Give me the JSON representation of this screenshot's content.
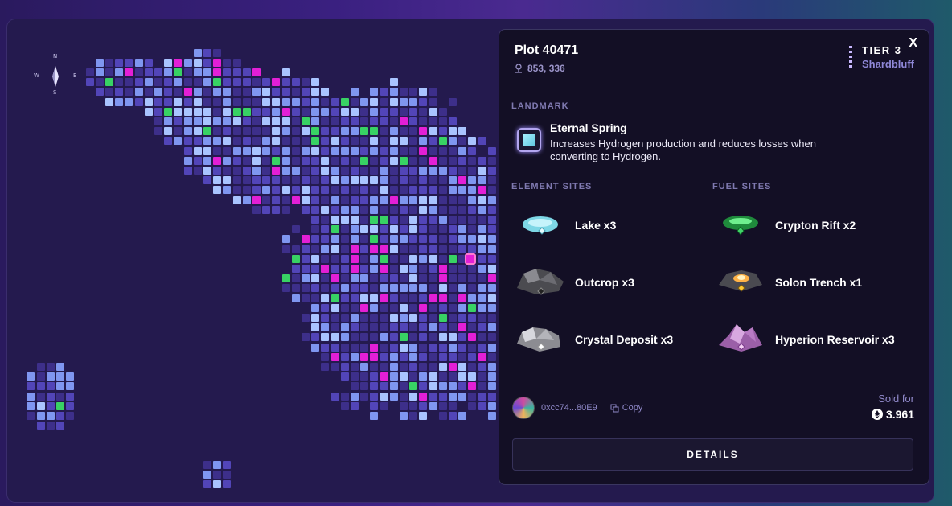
{
  "compass": {
    "n": "N",
    "s": "S",
    "w": "W",
    "e": "E"
  },
  "map": {
    "selected_tile_color": "#ff7bd0",
    "colors": {
      "dark": "#3d2f8a",
      "mid": "#5245b8",
      "light": "#7f96f0",
      "pale": "#a9c4ff",
      "pink": "#e31fd6",
      "green": "#38d264"
    }
  },
  "panel": {
    "close_label": "X",
    "plot_title": "Plot 40471",
    "coords": "853, 336",
    "tier": "TIER 3",
    "region": "Shardbluff",
    "landmark_heading": "LANDMARK",
    "landmark_name": "Eternal Spring",
    "landmark_desc": "Increases Hydrogen production and reduces losses when converting to Hydrogen.",
    "element_heading": "ELEMENT SITES",
    "fuel_heading": "FUEL SITES",
    "element_sites": [
      {
        "label": "Lake x3",
        "icon": "lake-icon"
      },
      {
        "label": "Outcrop x3",
        "icon": "outcrop-icon"
      },
      {
        "label": "Crystal Deposit x3",
        "icon": "crystal-deposit-icon"
      }
    ],
    "fuel_sites": [
      {
        "label": "Crypton Rift x2",
        "icon": "crypton-rift-icon"
      },
      {
        "label": "Solon Trench x1",
        "icon": "solon-trench-icon"
      },
      {
        "label": "Hyperion Reservoir x3",
        "icon": "hyperion-reservoir-icon"
      }
    ],
    "owner_address": "0xcc74...80E9",
    "copy_label": "Copy",
    "sold_label": "Sold for",
    "sold_value": "3.961",
    "details_label": "DETAILS"
  }
}
